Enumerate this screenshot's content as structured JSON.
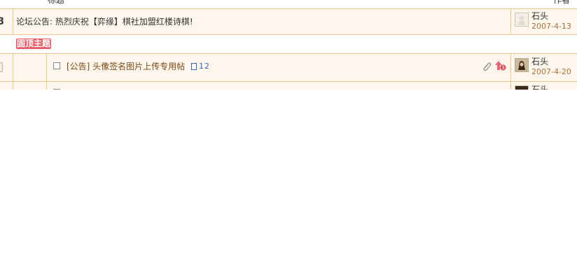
{
  "header": {
    "title_col": "标题",
    "author_col": "作者"
  },
  "notice": {
    "text": "论坛公告: 热烈庆祝【弈缘】棋社加盟红楼诗棋!",
    "author": "石头",
    "date": "2007-4-13",
    "icons": {
      "avatar": "default-avatar-icon"
    }
  },
  "section": {
    "label": "固顶主题"
  },
  "topics": [
    {
      "title": "[公告] 头像签名图片上传专用帖",
      "pages": [
        "1",
        "2"
      ],
      "author": "石头",
      "date": "2007-4-20",
      "icons": {
        "page": "document-page-icon",
        "attachment": "paperclip-icon",
        "hot": "hot-up-arrow-icon",
        "avatar": "user-avatar-icon"
      },
      "hot_count": "3"
    },
    {
      "title": "",
      "author": "石头"
    }
  ],
  "colors": {
    "border": "#f1c98a",
    "row_bg": "#fdf6ec",
    "section_label_bg": "#e65c69",
    "date_color": "#a8733c",
    "link_color": "#3a64b4",
    "title_color": "#7a4a17"
  }
}
